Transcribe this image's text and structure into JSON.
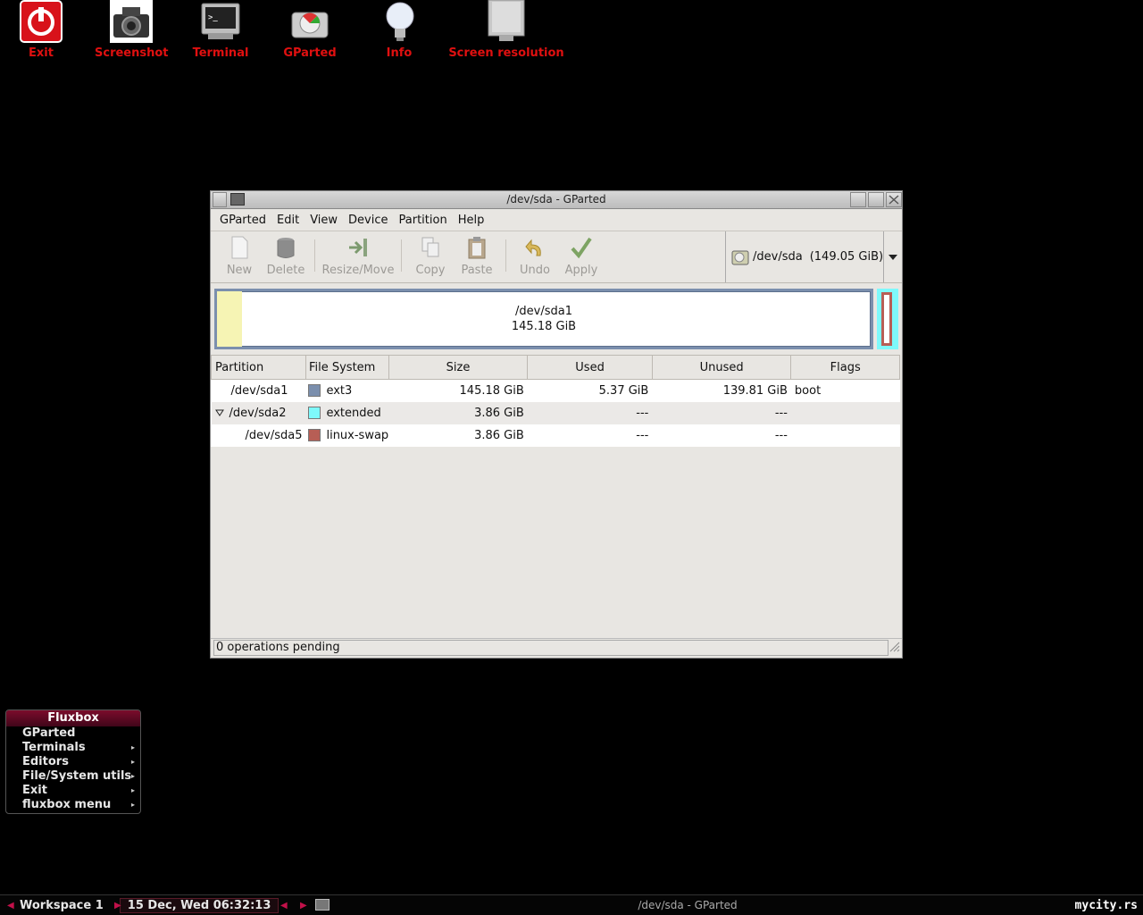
{
  "desktop_icons": [
    {
      "name": "exit-icon",
      "label": "Exit"
    },
    {
      "name": "camera-icon",
      "label": "Screenshot"
    },
    {
      "name": "terminal-icon",
      "label": "Terminal"
    },
    {
      "name": "gparted-icon",
      "label": "GParted"
    },
    {
      "name": "lightbulb-icon",
      "label": "Info"
    },
    {
      "name": "monitor-icon",
      "label": "Screen resolution"
    }
  ],
  "window": {
    "title": "/dev/sda - GParted",
    "menu": [
      "GParted",
      "Edit",
      "View",
      "Device",
      "Partition",
      "Help"
    ],
    "toolbar": {
      "new": "New",
      "delete": "Delete",
      "resize": "Resize/Move",
      "copy": "Copy",
      "paste": "Paste",
      "undo": "Undo",
      "apply": "Apply"
    },
    "device_selector": {
      "device": "/dev/sda",
      "size": "(149.05 GiB)"
    },
    "graph": {
      "name": "/dev/sda1",
      "size": "145.18 GiB"
    },
    "columns": [
      "Partition",
      "File System",
      "Size",
      "Used",
      "Unused",
      "Flags"
    ],
    "rows": [
      {
        "partition": "/dev/sda1",
        "fs": "ext3",
        "size": "145.18 GiB",
        "used": "5.37 GiB",
        "unused": "139.81 GiB",
        "flags": "boot",
        "color": "#7b8fad"
      },
      {
        "partition": "/dev/sda2",
        "fs": "extended",
        "size": "3.86 GiB",
        "used": "---",
        "unused": "---",
        "flags": "",
        "color": "#7ef9fb"
      },
      {
        "partition": "/dev/sda5",
        "fs": "linux-swap",
        "size": "3.86 GiB",
        "used": "---",
        "unused": "---",
        "flags": "",
        "color": "#b75e55"
      }
    ],
    "status": "0 operations pending"
  },
  "fluxbox_menu": {
    "title": "Fluxbox",
    "items": [
      "GParted",
      "Terminals",
      "Editors",
      "File/System utils",
      "Exit",
      "fluxbox menu"
    ]
  },
  "taskbar": {
    "workspace": "Workspace 1",
    "clock": "15 Dec, Wed 06:32:13",
    "task": "/dev/sda - GParted",
    "brand": "mycity.rs"
  }
}
